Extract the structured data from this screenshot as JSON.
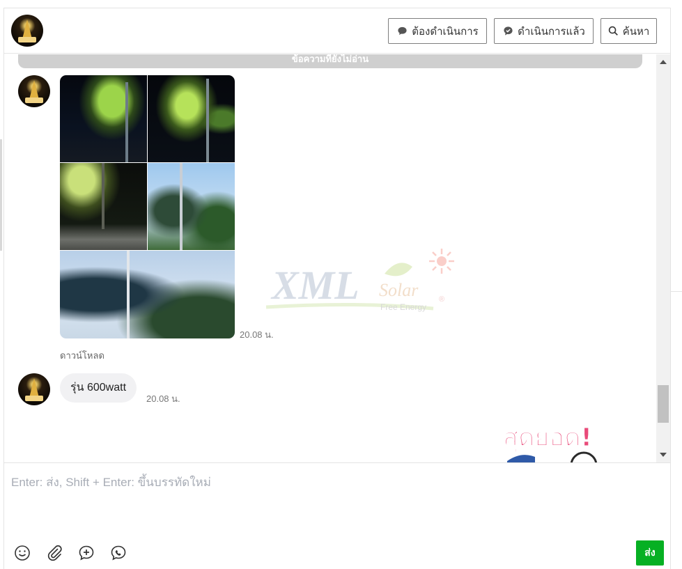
{
  "header": {
    "buttons": {
      "todo": "ต้องดำเนินการ",
      "done": "ดำเนินการแล้ว",
      "search": "ค้นหา"
    }
  },
  "chat": {
    "unread_label": "ข้อความที่ยังไม่อ่าน",
    "messages": [
      {
        "type": "photos",
        "time": "20.08 น.",
        "download_label": "ดาวน์โหลด"
      },
      {
        "type": "text",
        "text": "รุ่น 600watt",
        "time": "20.08 น."
      }
    ],
    "sticker_text": "สุดยอด!",
    "watermark": {
      "main": "XML",
      "sub": "Solar",
      "tag": "Free Energy",
      "registered": "®"
    }
  },
  "composer": {
    "placeholder": "Enter: ส่ง, Shift + Enter: ขึ้นบรรทัดใหม่",
    "value": "",
    "send_label": "ส่ง"
  },
  "colors": {
    "send_green": "#06b023",
    "unread_bar": "#cfcfcf",
    "bubble_bg": "#f1f1f3",
    "sticker_pink": "#e94b7a"
  }
}
